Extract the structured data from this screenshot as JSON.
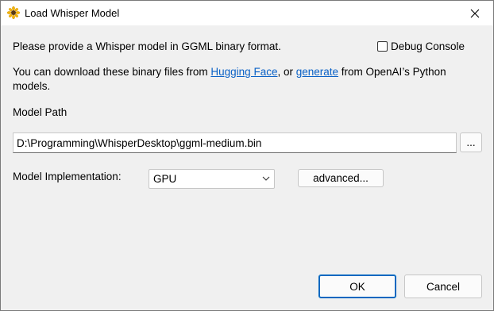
{
  "window": {
    "title": "Load Whisper Model",
    "icon": "sunflower-icon"
  },
  "intro": {
    "text": "Please provide a Whisper model in GGML binary format."
  },
  "debug": {
    "label": "Debug Console",
    "checked": false
  },
  "download": {
    "prefix": "You can download these binary files from ",
    "link1": "Hugging Face",
    "middle": ", or ",
    "link2": "generate",
    "suffix": " from OpenAI’s Python",
    "line2": "models."
  },
  "model_path": {
    "label": "Model Path",
    "value": "D:\\Programming\\WhisperDesktop\\ggml-medium.bin",
    "browse_label": "..."
  },
  "implementation": {
    "label": "Model Implementation:",
    "value": "GPU",
    "advanced_label": "advanced..."
  },
  "buttons": {
    "ok": "OK",
    "cancel": "Cancel"
  },
  "colors": {
    "link": "#0a61c6",
    "accent": "#0067c0",
    "background": "#f0f0f0"
  }
}
